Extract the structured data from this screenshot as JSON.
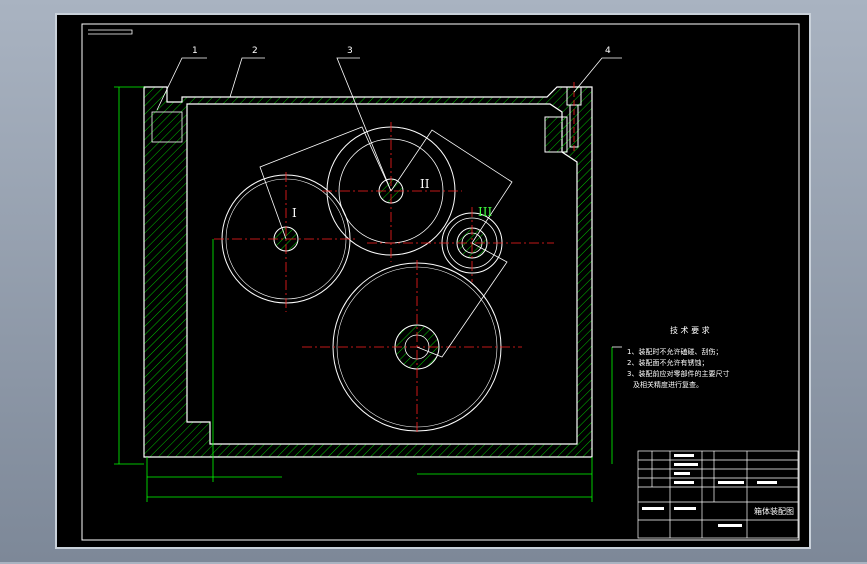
{
  "drawing": {
    "balloons": [
      "1",
      "2",
      "3",
      "4"
    ],
    "gear_labels": [
      "I",
      "II",
      "III"
    ],
    "technical_requirements": {
      "title": "技 术 要 求",
      "items": [
        "1、装配时不允许磕碰、刮伤；",
        "2、装配面不允许有锈蚀；",
        "3、装配前应对零部件的主要尺寸",
        "及相关精度进行复查。"
      ]
    },
    "title_block": {
      "drawing_name": "箱体装配图"
    }
  },
  "colors": {
    "background": "#000000",
    "outline": "#ffffff",
    "hatch": "#00c000",
    "centerline": "#ff2020",
    "dimension": "#00ff00",
    "leader": "#ffffff",
    "roman_numerals": "#ffffff",
    "gear_III_label": "#40ff40"
  }
}
